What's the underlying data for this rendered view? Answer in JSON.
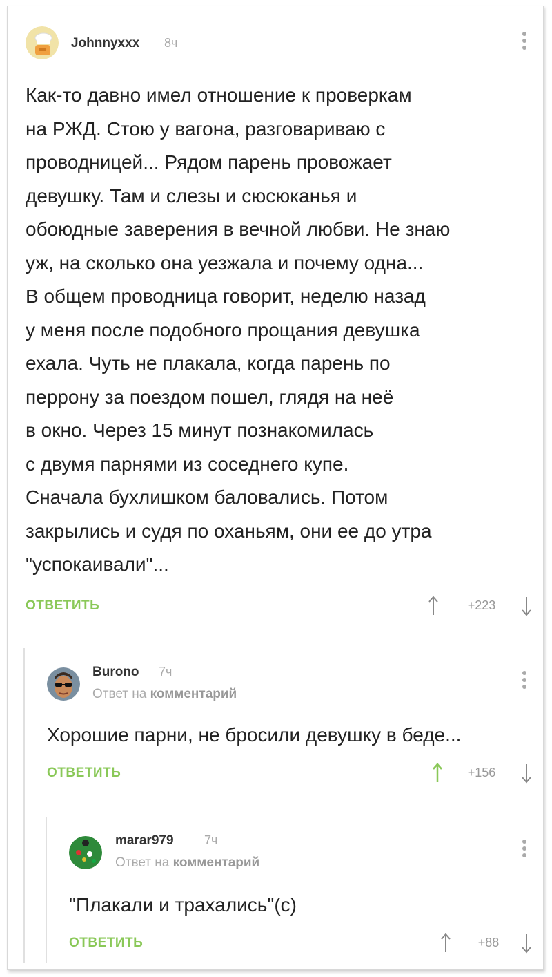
{
  "colors": {
    "accent": "#8ac858",
    "muted": "#aaaaaa",
    "text": "#222222"
  },
  "comments": [
    {
      "username": "Johnnyxxx",
      "time": "8ч",
      "avatar_icon": "cook-hat-avatar",
      "lines": [
        "Как-то давно имел отношение к проверкам",
        "на РЖД. Стою у вагона, разговариваю с",
        "проводницей... Рядом парень провожает",
        "девушку. Там и слезы и сюсюканья и",
        "обоюдные заверения в вечной любви. Не знаю",
        "уж, на сколько она уезжала и почему одна...",
        "В общем проводница говорит, неделю назад",
        "у меня после подобного прощания девушка",
        "ехала. Чуть не плакала, когда парень по",
        "перрону за поездом пошел, глядя на неё",
        "в окно. Через 15 минут познакомилась",
        "с двумя парнями из соседнего купе.",
        "Сначала бухлишком баловались. Потом",
        "закрылись и судя по оханьям, они ее до утра",
        "\"успокаивали\"..."
      ],
      "reply_label": "ОТВЕТИТЬ",
      "score": "+223",
      "upvoted": false
    },
    {
      "username": "Burono",
      "time": "7ч",
      "avatar_icon": "man-sunglasses-avatar",
      "reply_prefix": "Ответ на",
      "reply_target": "комментарий",
      "lines": [
        "Хорошие парни, не бросили девушку в беде..."
      ],
      "reply_label": "ОТВЕТИТЬ",
      "score": "+156",
      "upvoted": true
    },
    {
      "username": "marar979",
      "time": "7ч",
      "avatar_icon": "snooker-table-avatar",
      "reply_prefix": "Ответ на",
      "reply_target": "комментарий",
      "lines": [
        "\"Плакали и трахались\"(с)"
      ],
      "reply_label": "ОТВЕТИТЬ",
      "score": "+88",
      "upvoted": false
    }
  ]
}
